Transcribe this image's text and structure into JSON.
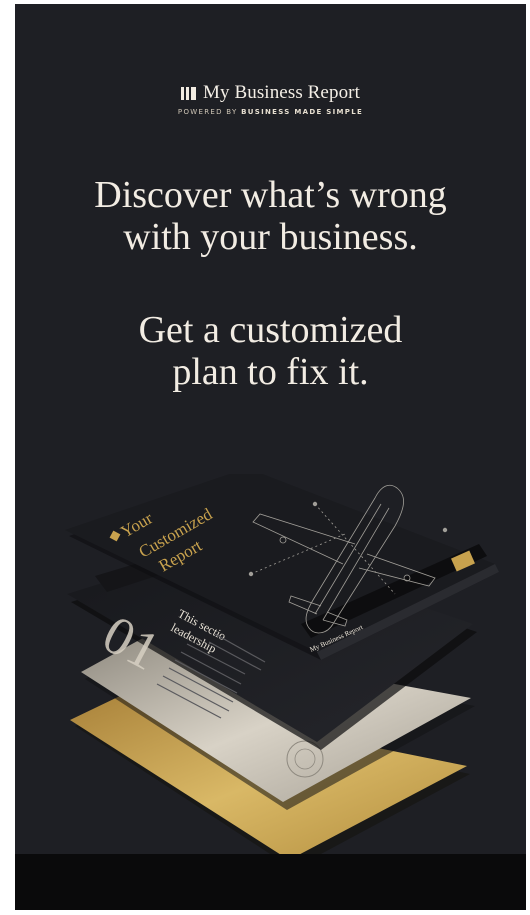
{
  "logo": {
    "title": "My Business Report",
    "powered_by": "POWERED BY",
    "brand": "BUSINESS MADE SIMPLE"
  },
  "headline": {
    "line1": "Discover what’s wrong",
    "line2": "with your business.",
    "line3": "Get a customized",
    "line4": "plan to fix it."
  },
  "report": {
    "cover_title_1": "Your",
    "cover_title_2": "Customized",
    "cover_title_3": "Report",
    "tab_label": "My Business Report",
    "section_number": "01",
    "section_teaser_1": "This sectio",
    "section_teaser_2": "leadership"
  },
  "colors": {
    "background": "#1e1f24",
    "gold": "#c8a24e",
    "cream": "#f2ece3"
  }
}
